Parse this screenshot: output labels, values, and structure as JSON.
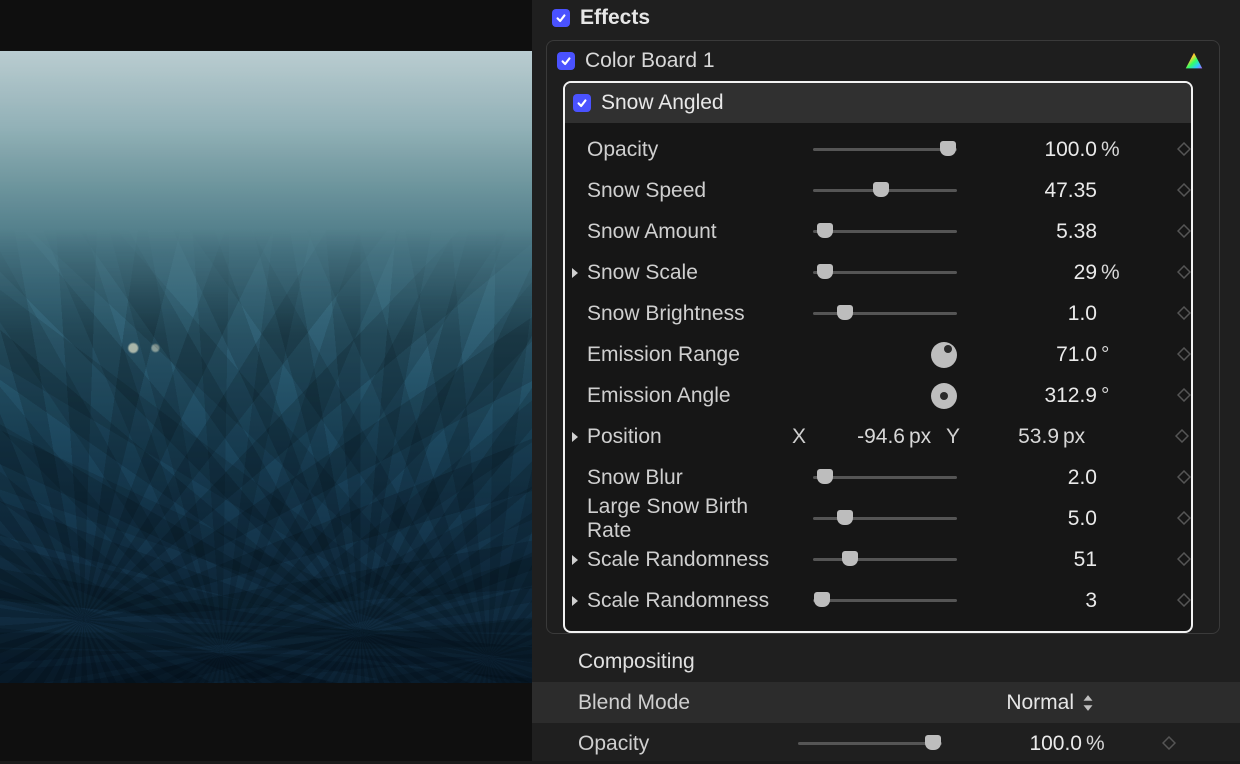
{
  "sections": {
    "effects": {
      "title": "Effects",
      "items": [
        {
          "label": "Color Board 1",
          "checked": true
        },
        {
          "label": "Snow Angled",
          "checked": true
        }
      ]
    },
    "compositing": {
      "title": "Compositing",
      "blend_label": "Blend Mode",
      "blend_value": "Normal",
      "opacity_label": "Opacity",
      "opacity_value": "100.0",
      "opacity_unit": "%"
    }
  },
  "selected_effect": {
    "label": "Snow Angled",
    "params": [
      {
        "id": "opacity",
        "label": "Opacity",
        "control": "slider",
        "thumb_pct": 94,
        "value": "100.0",
        "unit": "%"
      },
      {
        "id": "snow-speed",
        "label": "Snow Speed",
        "control": "slider",
        "thumb_pct": 47,
        "value": "47.35",
        "unit": ""
      },
      {
        "id": "snow-amount",
        "label": "Snow Amount",
        "control": "slider",
        "thumb_pct": 8,
        "value": "5.38",
        "unit": ""
      },
      {
        "id": "snow-scale",
        "label": "Snow Scale",
        "control": "slider",
        "thumb_pct": 8,
        "value": "29",
        "unit": "%",
        "disclosure": true
      },
      {
        "id": "snow-bright",
        "label": "Snow Brightness",
        "control": "slider",
        "thumb_pct": 22,
        "value": "1.0",
        "unit": ""
      },
      {
        "id": "em-range",
        "label": "Emission Range",
        "control": "dial",
        "dial": "tr",
        "value": "71.0",
        "unit": "°"
      },
      {
        "id": "em-angle",
        "label": "Emission Angle",
        "control": "dial",
        "dial": "c",
        "value": "312.9",
        "unit": "°"
      },
      {
        "id": "position",
        "label": "Position",
        "control": "position",
        "x": "-94.6",
        "xu": "px",
        "y": "53.9",
        "yu": "px",
        "disclosure": true
      },
      {
        "id": "snow-blur",
        "label": "Snow Blur",
        "control": "slider",
        "thumb_pct": 8,
        "value": "2.0",
        "unit": ""
      },
      {
        "id": "lsbr",
        "label": "Large Snow Birth Rate",
        "control": "slider",
        "thumb_pct": 22,
        "value": "5.0",
        "unit": ""
      },
      {
        "id": "scale-rand1",
        "label": "Scale Randomness",
        "control": "slider",
        "thumb_pct": 26,
        "value": "51",
        "unit": "",
        "disclosure": true
      },
      {
        "id": "scale-rand2",
        "label": "Scale Randomness",
        "control": "slider",
        "thumb_pct": 6,
        "value": "3",
        "unit": "",
        "disclosure": true
      }
    ]
  },
  "axes": {
    "x_label": "X",
    "y_label": "Y"
  }
}
